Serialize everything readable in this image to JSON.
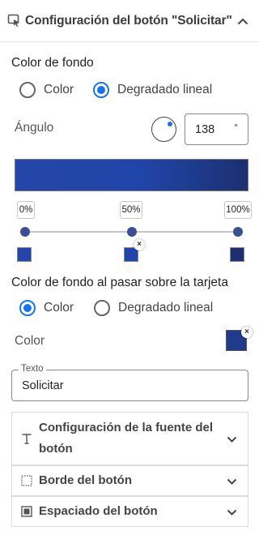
{
  "header": {
    "title": "Configuración del botón \"Solicitar\""
  },
  "background": {
    "label": "Color de fondo",
    "options": [
      "Color",
      "Degradado lineal"
    ],
    "selected": 1,
    "angle_label": "Ángulo",
    "angle_value": "138",
    "angle_unit": "°",
    "gradient_colors": [
      "#2446a8",
      "#2045a8",
      "#1c2f70"
    ],
    "stops": [
      {
        "label": "0%",
        "color": "#2446a8"
      },
      {
        "label": "50%",
        "color": "#2045a8"
      },
      {
        "label": "100%",
        "color": "#1c2f70"
      }
    ],
    "remove_mark": "×"
  },
  "hover": {
    "label": "Color de fondo al pasar sobre la tarjeta",
    "options": [
      "Color",
      "Degradado lineal"
    ],
    "selected": 0,
    "color_label": "Color",
    "color": "#213a8c",
    "remove_mark": "×"
  },
  "text_field": {
    "legend": "Texto",
    "value": "Solicitar"
  },
  "accordions": [
    {
      "title_line1": "Configuración de la fuente del",
      "title_line2": "botón",
      "icon": "text-icon"
    },
    {
      "title": "Borde del botón",
      "icon": "border-icon"
    },
    {
      "title": "Espaciado del botón",
      "icon": "padding-icon"
    }
  ]
}
